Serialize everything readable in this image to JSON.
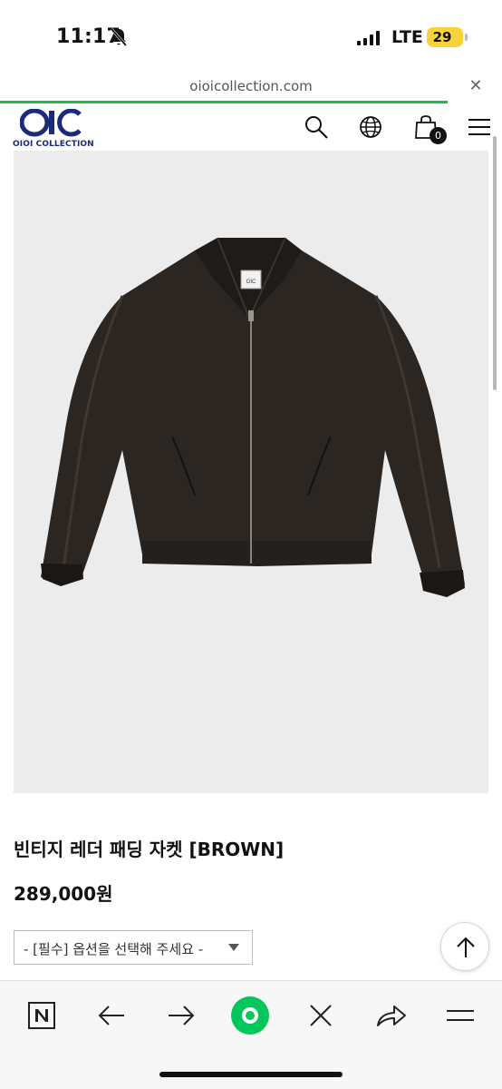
{
  "status_bar": {
    "time": "11:17",
    "network": "LTE",
    "battery": "29",
    "colors": {
      "battery": "#f7d23b"
    },
    "icons": [
      "bell-off-icon",
      "signal-icon",
      "battery-icon"
    ]
  },
  "browser": {
    "url": "oioicollection.com",
    "close_icon": "close-icon",
    "colors": {
      "load_progress": "#22b84a"
    }
  },
  "site_header": {
    "logo_text": "OIOI COLLECTION",
    "cart_count": "0",
    "icons": [
      "search-icon",
      "globe-icon",
      "shopping-bag-icon",
      "menu-icon"
    ],
    "colors": {
      "brand": "#1b2a7a"
    }
  },
  "product": {
    "title": "빈티지 레더 패딩 자켓 [BROWN]",
    "price": "289,000원",
    "option_placeholder": "- [필수] 옵션을 선택해 주세요 -",
    "image_label": "OIC"
  },
  "toolbar": {
    "icons": [
      "naver-icon",
      "back-arrow-icon",
      "forward-arrow-icon",
      "green-dot-icon",
      "close-icon",
      "share-icon",
      "menu-icon"
    ],
    "colors": {
      "green": "#03c75a"
    }
  }
}
